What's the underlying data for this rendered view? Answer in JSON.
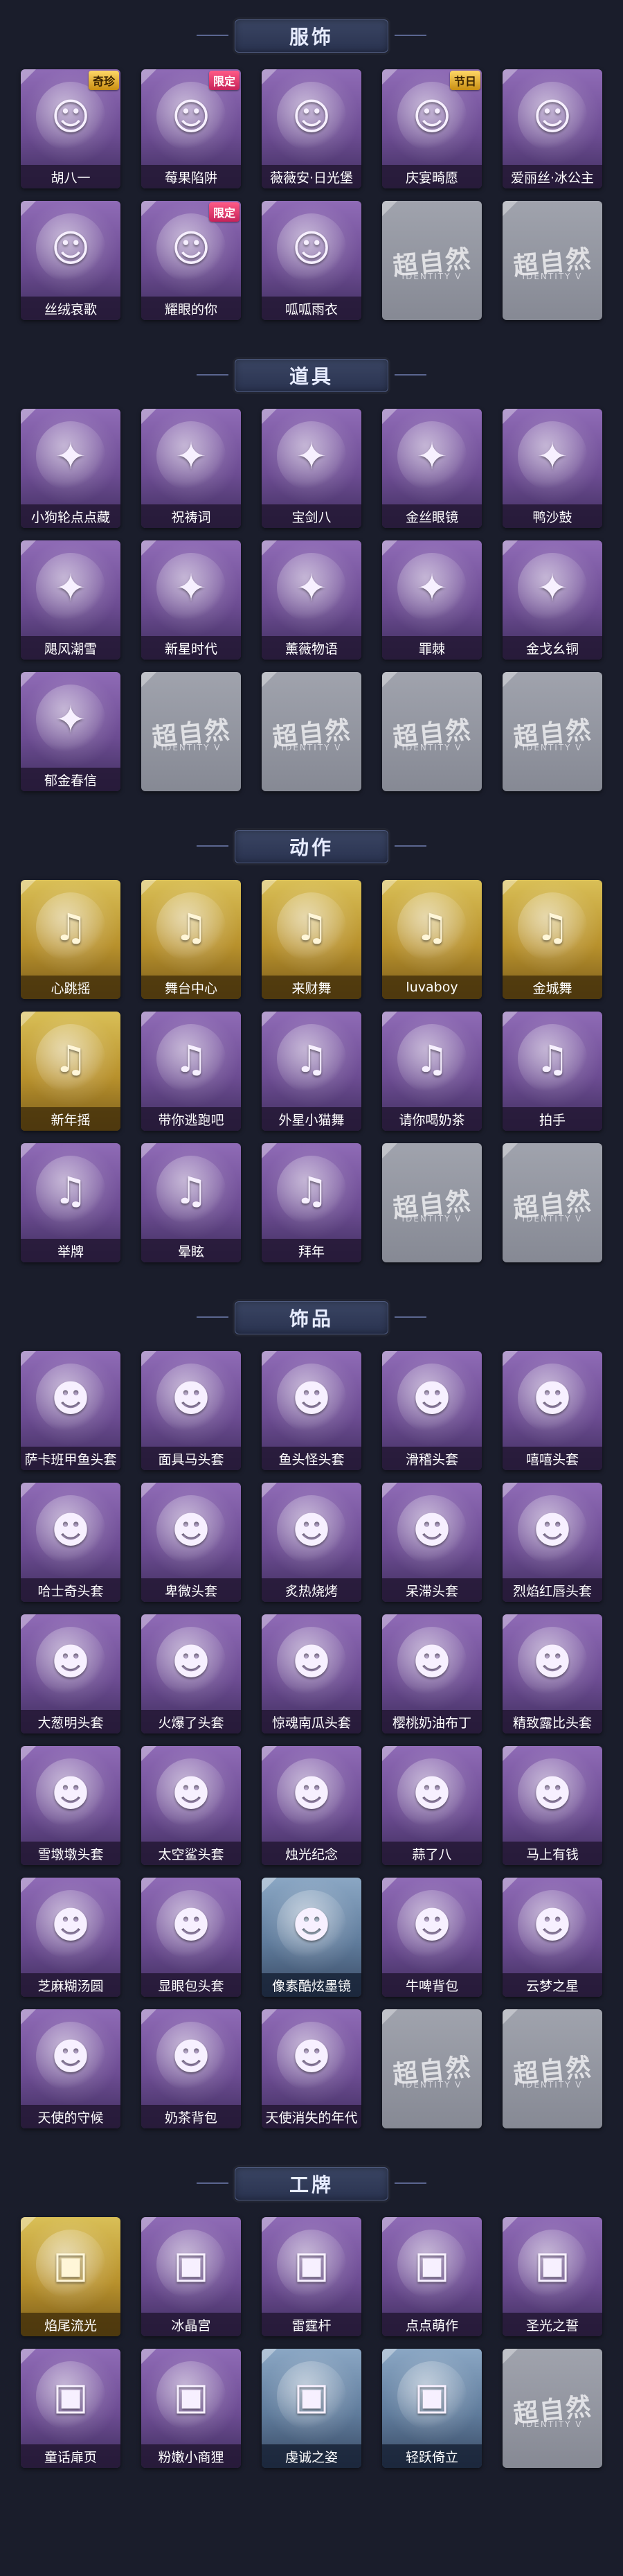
{
  "watermark": {
    "text": "超自然",
    "sub": "IDENTITY V"
  },
  "colors": {
    "page_bg": "#1a1d2b",
    "purple_tile": "#8f6bb6",
    "gold_tile": "#d9bf57",
    "blue_tile": "#8ba7c4",
    "empty_tile": "#a0a3ad",
    "header_plate": "#3a4563"
  },
  "sections": [
    {
      "title": "服饰",
      "items": [
        {
          "label": "胡八一",
          "badge": "奇珍",
          "tier": "purple",
          "icon": "character-portrait-icon"
        },
        {
          "label": "莓果陷阱",
          "badge": "限定",
          "tier": "purple",
          "icon": "character-portrait-icon"
        },
        {
          "label": "薇薇安·日光堡",
          "badge": "",
          "tier": "purple",
          "icon": "character-portrait-icon"
        },
        {
          "label": "庆宴畸愿",
          "badge": "节日",
          "tier": "purple",
          "icon": "character-portrait-icon"
        },
        {
          "label": "爱丽丝·冰公主",
          "badge": "",
          "tier": "purple",
          "icon": "character-portrait-icon"
        },
        {
          "label": "丝绒哀歌",
          "badge": "",
          "tier": "purple",
          "icon": "character-portrait-icon"
        },
        {
          "label": "耀眼的你",
          "badge": "限定",
          "tier": "purple",
          "icon": "character-portrait-icon"
        },
        {
          "label": "呱呱雨衣",
          "badge": "",
          "tier": "purple",
          "icon": "character-portrait-icon"
        },
        {
          "label": "",
          "badge": "",
          "tier": "empty",
          "icon": "placeholder-icon"
        },
        {
          "label": "",
          "badge": "",
          "tier": "empty",
          "icon": "placeholder-icon"
        }
      ]
    },
    {
      "title": "道具",
      "items": [
        {
          "label": "小狗轮点点藏",
          "badge": "",
          "tier": "purple",
          "icon": "item-icon"
        },
        {
          "label": "祝祷词",
          "badge": "",
          "tier": "purple",
          "icon": "item-icon"
        },
        {
          "label": "宝剑八",
          "badge": "",
          "tier": "purple",
          "icon": "item-icon"
        },
        {
          "label": "金丝眼镜",
          "badge": "",
          "tier": "purple",
          "icon": "item-icon"
        },
        {
          "label": "鸭沙鼓",
          "badge": "",
          "tier": "purple",
          "icon": "item-icon"
        },
        {
          "label": "飓风潮雪",
          "badge": "",
          "tier": "purple",
          "icon": "item-icon"
        },
        {
          "label": "新星时代",
          "badge": "",
          "tier": "purple",
          "icon": "item-icon"
        },
        {
          "label": "薰薇物语",
          "badge": "",
          "tier": "purple",
          "icon": "item-icon"
        },
        {
          "label": "罪棘",
          "badge": "",
          "tier": "purple",
          "icon": "item-icon"
        },
        {
          "label": "金戈幺铜",
          "badge": "",
          "tier": "purple",
          "icon": "item-icon"
        },
        {
          "label": "郁金春信",
          "badge": "",
          "tier": "purple",
          "icon": "item-icon"
        },
        {
          "label": "",
          "badge": "",
          "tier": "empty",
          "icon": "placeholder-icon"
        },
        {
          "label": "",
          "badge": "",
          "tier": "empty",
          "icon": "placeholder-icon"
        },
        {
          "label": "",
          "badge": "",
          "tier": "empty",
          "icon": "placeholder-icon"
        },
        {
          "label": "",
          "badge": "",
          "tier": "empty",
          "icon": "placeholder-icon"
        }
      ]
    },
    {
      "title": "动作",
      "items": [
        {
          "label": "心跳摇",
          "badge": "",
          "tier": "gold",
          "icon": "dance-pose-icon"
        },
        {
          "label": "舞台中心",
          "badge": "",
          "tier": "gold",
          "icon": "dance-pose-icon"
        },
        {
          "label": "来财舞",
          "badge": "",
          "tier": "gold",
          "icon": "dance-pose-icon"
        },
        {
          "label": "luvaboy",
          "badge": "",
          "tier": "gold",
          "icon": "dance-pose-icon"
        },
        {
          "label": "金城舞",
          "badge": "",
          "tier": "gold",
          "icon": "dance-pose-icon"
        },
        {
          "label": "新年摇",
          "badge": "",
          "tier": "gold",
          "icon": "dance-pose-icon"
        },
        {
          "label": "带你逃跑吧",
          "badge": "",
          "tier": "purple",
          "icon": "dance-pose-icon"
        },
        {
          "label": "外星小猫舞",
          "badge": "",
          "tier": "purple",
          "icon": "dance-pose-icon"
        },
        {
          "label": "请你喝奶茶",
          "badge": "",
          "tier": "purple",
          "icon": "dance-pose-icon"
        },
        {
          "label": "拍手",
          "badge": "",
          "tier": "purple",
          "icon": "dance-pose-icon"
        },
        {
          "label": "举牌",
          "badge": "",
          "tier": "purple",
          "icon": "dance-pose-icon"
        },
        {
          "label": "晕眩",
          "badge": "",
          "tier": "purple",
          "icon": "dance-pose-icon"
        },
        {
          "label": "拜年",
          "badge": "",
          "tier": "purple",
          "icon": "dance-pose-icon"
        },
        {
          "label": "",
          "badge": "",
          "tier": "empty",
          "icon": "placeholder-icon"
        },
        {
          "label": "",
          "badge": "",
          "tier": "empty",
          "icon": "placeholder-icon"
        }
      ]
    },
    {
      "title": "饰品",
      "items": [
        {
          "label": "萨卡班甲鱼头套",
          "badge": "",
          "tier": "purple",
          "icon": "head-accessory-icon"
        },
        {
          "label": "面具马头套",
          "badge": "",
          "tier": "purple",
          "icon": "head-accessory-icon"
        },
        {
          "label": "鱼头怪头套",
          "badge": "",
          "tier": "purple",
          "icon": "head-accessory-icon"
        },
        {
          "label": "滑稽头套",
          "badge": "",
          "tier": "purple",
          "icon": "head-accessory-icon"
        },
        {
          "label": "嘻嘻头套",
          "badge": "",
          "tier": "purple",
          "icon": "head-accessory-icon"
        },
        {
          "label": "哈士奇头套",
          "badge": "",
          "tier": "purple",
          "icon": "head-accessory-icon"
        },
        {
          "label": "卑微头套",
          "badge": "",
          "tier": "purple",
          "icon": "head-accessory-icon"
        },
        {
          "label": "炙热烧烤",
          "badge": "",
          "tier": "purple",
          "icon": "head-accessory-icon"
        },
        {
          "label": "呆滞头套",
          "badge": "",
          "tier": "purple",
          "icon": "head-accessory-icon"
        },
        {
          "label": "烈焰红唇头套",
          "badge": "",
          "tier": "purple",
          "icon": "head-accessory-icon"
        },
        {
          "label": "大葱明头套",
          "badge": "",
          "tier": "purple",
          "icon": "head-accessory-icon"
        },
        {
          "label": "火爆了头套",
          "badge": "",
          "tier": "purple",
          "icon": "head-accessory-icon"
        },
        {
          "label": "惊魂南瓜头套",
          "badge": "",
          "tier": "purple",
          "icon": "head-accessory-icon"
        },
        {
          "label": "樱桃奶油布丁",
          "badge": "",
          "tier": "purple",
          "icon": "head-accessory-icon"
        },
        {
          "label": "精致露比头套",
          "badge": "",
          "tier": "purple",
          "icon": "head-accessory-icon"
        },
        {
          "label": "雪墩墩头套",
          "badge": "",
          "tier": "purple",
          "icon": "head-accessory-icon"
        },
        {
          "label": "太空鲨头套",
          "badge": "",
          "tier": "purple",
          "icon": "head-accessory-icon"
        },
        {
          "label": "烛光纪念",
          "badge": "",
          "tier": "purple",
          "icon": "head-accessory-icon"
        },
        {
          "label": "蒜了八",
          "badge": "",
          "tier": "purple",
          "icon": "head-accessory-icon"
        },
        {
          "label": "马上有钱",
          "badge": "",
          "tier": "purple",
          "icon": "head-accessory-icon"
        },
        {
          "label": "芝麻糊汤圆",
          "badge": "",
          "tier": "purple",
          "icon": "head-accessory-icon"
        },
        {
          "label": "显眼包头套",
          "badge": "",
          "tier": "purple",
          "icon": "head-accessory-icon"
        },
        {
          "label": "像素酷炫墨镜",
          "badge": "",
          "tier": "blue",
          "icon": "head-accessory-icon"
        },
        {
          "label": "牛啤背包",
          "badge": "",
          "tier": "purple",
          "icon": "head-accessory-icon"
        },
        {
          "label": "云梦之星",
          "badge": "",
          "tier": "purple",
          "icon": "head-accessory-icon"
        },
        {
          "label": "天使的守候",
          "badge": "",
          "tier": "purple",
          "icon": "head-accessory-icon"
        },
        {
          "label": "奶茶背包",
          "badge": "",
          "tier": "purple",
          "icon": "head-accessory-icon"
        },
        {
          "label": "天使消失的年代",
          "badge": "",
          "tier": "purple",
          "icon": "head-accessory-icon"
        },
        {
          "label": "",
          "badge": "",
          "tier": "empty",
          "icon": "placeholder-icon"
        },
        {
          "label": "",
          "badge": "",
          "tier": "empty",
          "icon": "placeholder-icon"
        }
      ]
    },
    {
      "title": "工牌",
      "items": [
        {
          "label": "焰尾流光",
          "badge": "",
          "tier": "gold",
          "icon": "badge-card-icon"
        },
        {
          "label": "冰晶宫",
          "badge": "",
          "tier": "purple",
          "icon": "badge-card-icon"
        },
        {
          "label": "雷霆杆",
          "badge": "",
          "tier": "purple",
          "icon": "badge-card-icon"
        },
        {
          "label": "点点萌作",
          "badge": "",
          "tier": "purple",
          "icon": "badge-card-icon"
        },
        {
          "label": "圣光之誓",
          "badge": "",
          "tier": "purple",
          "icon": "badge-card-icon"
        },
        {
          "label": "童话扉页",
          "badge": "",
          "tier": "purple",
          "icon": "badge-card-icon"
        },
        {
          "label": "粉嫩小商狸",
          "badge": "",
          "tier": "purple",
          "icon": "badge-card-icon"
        },
        {
          "label": "虔诚之姿",
          "badge": "",
          "tier": "blue",
          "icon": "badge-card-icon"
        },
        {
          "label": "轻跃倚立",
          "badge": "",
          "tier": "blue",
          "icon": "badge-card-icon"
        },
        {
          "label": "",
          "badge": "",
          "tier": "empty",
          "icon": "placeholder-icon"
        }
      ]
    }
  ]
}
